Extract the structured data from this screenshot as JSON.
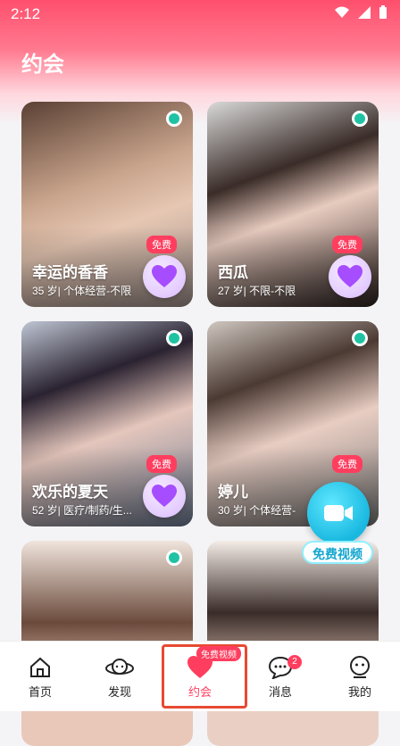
{
  "status_bar": {
    "time": "2:12"
  },
  "page": {
    "title": "约会"
  },
  "cards": [
    {
      "name": "幸运的香香",
      "info": "35 岁| 个体经营-不限",
      "free": "免费"
    },
    {
      "name": "西瓜",
      "info": "27 岁| 不限-不限",
      "free": "免费"
    },
    {
      "name": "欢乐的夏天",
      "info": "52 岁| 医疗/制药/生...",
      "free": "免费"
    },
    {
      "name": "婷儿",
      "info": "30 岁| 个体经营-",
      "free": "免费"
    },
    {
      "name": "",
      "info": "",
      "free": ""
    },
    {
      "name": "",
      "info": "",
      "free": ""
    }
  ],
  "fab": {
    "label": "免费视频"
  },
  "bottom_nav": {
    "items": [
      {
        "label": "首页",
        "icon": "home-icon"
      },
      {
        "label": "发现",
        "icon": "planet-icon"
      },
      {
        "label": "约会",
        "icon": "heart-icon",
        "badge": "免费视频"
      },
      {
        "label": "消息",
        "icon": "chat-icon",
        "count": "2"
      },
      {
        "label": "我的",
        "icon": "user-icon"
      }
    ]
  },
  "colors": {
    "accent": "#ff3e5f",
    "online": "#1fc3a3",
    "video": "#19b8e0"
  }
}
